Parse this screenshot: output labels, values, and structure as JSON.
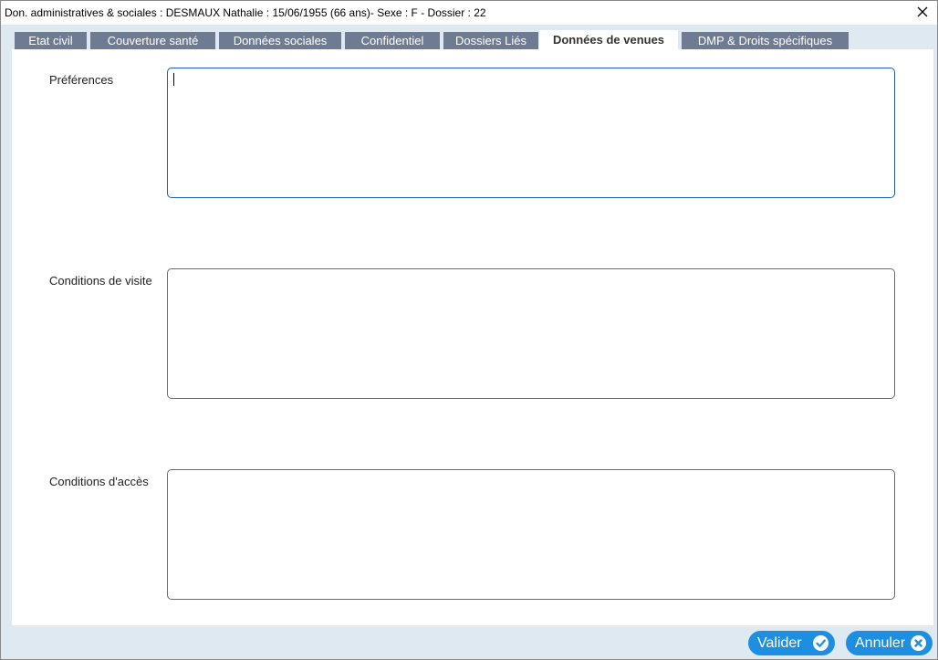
{
  "window": {
    "title": "Don. administratives & sociales : DESMAUX Nathalie : 15/06/1955 (66 ans)- Sexe : F - Dossier : 22"
  },
  "tabs": [
    {
      "label": "Etat civil",
      "active": false
    },
    {
      "label": "Couverture santé",
      "active": false
    },
    {
      "label": "Données sociales",
      "active": false
    },
    {
      "label": "Confidentiel",
      "active": false
    },
    {
      "label": "Dossiers Liés",
      "active": false
    },
    {
      "label": "Données de venues",
      "active": true
    },
    {
      "label": "DMP & Droits spécifiques",
      "active": false
    }
  ],
  "form": {
    "preferences": {
      "label": "Préférences",
      "value": ""
    },
    "conditions_visite": {
      "label": "Conditions de visite",
      "value": ""
    },
    "conditions_acces": {
      "label": "Conditions d'accès",
      "value": ""
    }
  },
  "footer": {
    "validate_label": "Valider",
    "cancel_label": "Annuler"
  },
  "icons": {
    "close": "close-icon",
    "validate": "checkmark-icon",
    "cancel": "cross-icon"
  },
  "colors": {
    "tab_inactive": "#6e7b93",
    "tab_active_text": "#333333",
    "button": "#1e8fe0",
    "background": "#dfe9f1",
    "focus_border": "#1c5fa8"
  }
}
